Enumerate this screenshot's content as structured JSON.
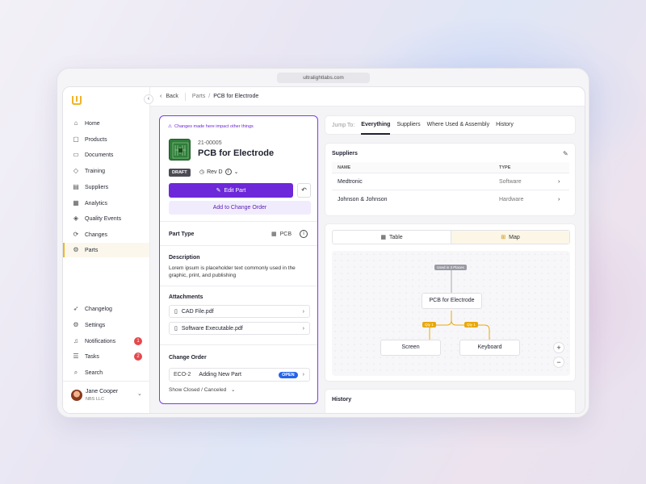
{
  "browser": {
    "url": "ultralightlabs.com"
  },
  "sidebar": {
    "items": [
      {
        "label": "Home",
        "icon": "home-icon"
      },
      {
        "label": "Products",
        "icon": "box-icon"
      },
      {
        "label": "Documents",
        "icon": "document-icon"
      },
      {
        "label": "Training",
        "icon": "graduation-cap-icon"
      },
      {
        "label": "Suppliers",
        "icon": "truck-icon"
      },
      {
        "label": "Analytics",
        "icon": "chart-icon"
      },
      {
        "label": "Quality Events",
        "icon": "quality-icon"
      },
      {
        "label": "Changes",
        "icon": "changes-icon"
      },
      {
        "label": "Parts",
        "icon": "parts-icon",
        "active": true
      }
    ],
    "bottom_items": [
      {
        "label": "Changelog",
        "icon": "rocket-icon"
      },
      {
        "label": "Settings",
        "icon": "gear-icon"
      },
      {
        "label": "Notifications",
        "icon": "bell-icon",
        "badge": "1"
      },
      {
        "label": "Tasks",
        "icon": "tasks-icon",
        "badge": "2"
      },
      {
        "label": "Search",
        "icon": "search-icon"
      }
    ],
    "user": {
      "name": "Jane Cooper",
      "org": "NBS LLC"
    }
  },
  "topbar": {
    "back_label": "Back",
    "breadcrumb_parent": "Parts",
    "breadcrumb_separator": "/",
    "breadcrumb_current": "PCB for Electrode"
  },
  "part": {
    "warning": "Changes made here impact other things",
    "number": "21-00005",
    "title": "PCB for Electrode",
    "status": "DRAFT",
    "revision": "Rev D",
    "edit_label": "Edit Part",
    "add_change_order_label": "Add to Change Order",
    "part_type_label": "Part Type",
    "part_type_value": "PCB",
    "description_label": "Description",
    "description_text": "Lorem ipsum is placeholder text commonly used in the graphic, print, and publishing",
    "attachments_label": "Attachments",
    "attachments": [
      "CAD File.pdf",
      "Software Executable.pdf"
    ],
    "change_order_label": "Change Order",
    "change_order": {
      "id": "ECO-2",
      "title": "Adding New Part",
      "status": "OPEN"
    },
    "show_closed_label": "Show Closed / Canceled"
  },
  "jump": {
    "label": "Jump To:",
    "tabs": [
      "Everything",
      "Suppliers",
      "Where Used & Assembly",
      "History"
    ],
    "active": "Everything"
  },
  "suppliers": {
    "title": "Suppliers",
    "columns": [
      "NAME",
      "TYPE"
    ],
    "rows": [
      {
        "name": "Medtronic",
        "type": "Software"
      },
      {
        "name": "Johnson & Johnson",
        "type": "Hardware"
      }
    ]
  },
  "where_used": {
    "view_options": [
      "Table",
      "Map"
    ],
    "active_view": "Map",
    "used_in_tag": "Used in 3 Places",
    "root_node": "PCB for Electrode",
    "children": [
      {
        "label": "Screen",
        "qty": "Qty 1"
      },
      {
        "label": "Keyboard",
        "qty": "Qty 1"
      }
    ],
    "zoom_in": "+",
    "zoom_out": "−"
  },
  "history": {
    "title": "History"
  },
  "colors": {
    "accent": "#6d28d9",
    "brand": "#f0b429",
    "open": "#2563eb",
    "badge": "#e5484d"
  }
}
